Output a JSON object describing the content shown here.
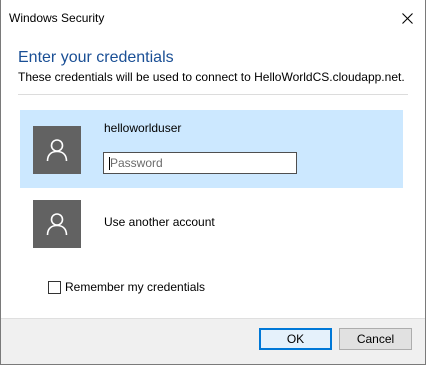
{
  "window": {
    "title": "Windows Security"
  },
  "dialog": {
    "heading": "Enter your credentials",
    "subheading": "These credentials will be used to connect to HelloWorldCS.cloudapp.net."
  },
  "accounts": {
    "selected": {
      "username": "helloworlduser",
      "password_value": "",
      "password_placeholder": "Password",
      "avatar_icon": "user-icon"
    },
    "other": {
      "label": "Use another account",
      "avatar_icon": "user-icon"
    }
  },
  "remember": {
    "label": "Remember my credentials",
    "checked": false
  },
  "buttons": {
    "ok_label": "OK",
    "cancel_label": "Cancel"
  },
  "colors": {
    "heading": "#1a4f95",
    "selection": "#cce8ff",
    "avatar": "#626262",
    "focus_border": "#0078d7"
  }
}
